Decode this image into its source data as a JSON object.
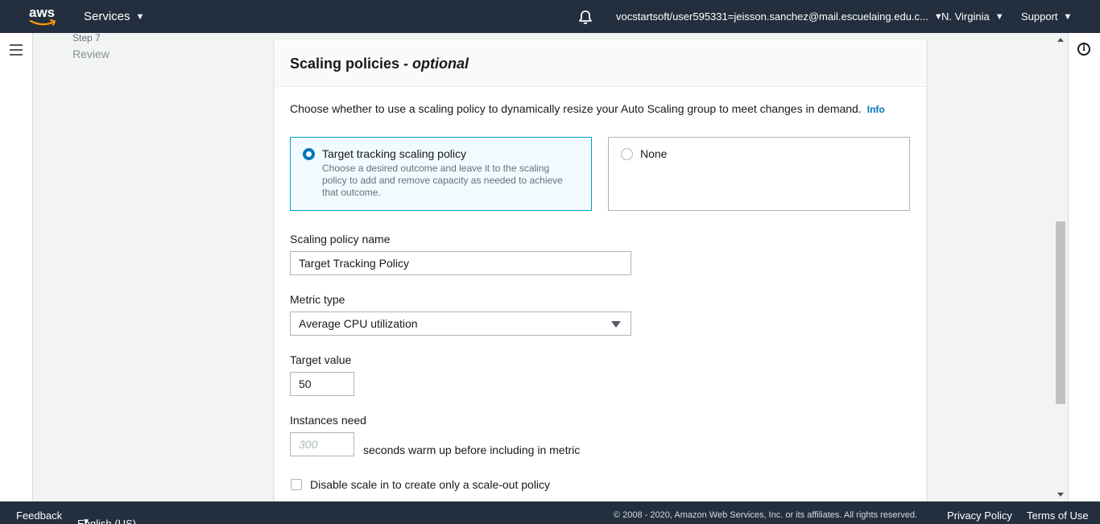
{
  "topnav": {
    "logo": "aws",
    "services": "Services",
    "account": "vocstartsoft/user595331=jeisson.sanchez@mail.escuelaing.edu.c...",
    "region": "N. Virginia",
    "support": "Support"
  },
  "steps": {
    "current_step_number": "Step 7",
    "current_step_label": "Review"
  },
  "section": {
    "title": "Scaling policies - ",
    "title_suffix": "optional",
    "description": "Choose whether to use a scaling policy to dynamically resize your Auto Scaling group to meet changes in demand.",
    "info_link": "Info"
  },
  "policy_options": [
    {
      "title": "Target tracking scaling policy",
      "description": "Choose a desired outcome and leave it to the scaling policy to add and remove capacity as needed to achieve that outcome.",
      "selected": true
    },
    {
      "title": "None",
      "description": "",
      "selected": false
    }
  ],
  "form": {
    "policy_name_label": "Scaling policy name",
    "policy_name_value": "Target Tracking Policy",
    "metric_type_label": "Metric type",
    "metric_type_value": "Average CPU utilization",
    "target_value_label": "Target value",
    "target_value": "50",
    "instances_need_label": "Instances need",
    "warmup_placeholder": "300",
    "warmup_suffix": "seconds warm up before including in metric",
    "disable_scale_in_label": "Disable scale in to create only a scale-out policy",
    "disable_scale_in_checked": false
  },
  "footer": {
    "feedback": "Feedback",
    "language": "English (US)",
    "copyright": "© 2008 - 2020, Amazon Web Services, Inc. or its affiliates. All rights reserved.",
    "privacy": "Privacy Policy",
    "terms": "Terms of Use"
  },
  "colors": {
    "nav_bg": "#232f3e",
    "accent": "#0073bb",
    "selected_border": "#00a1c9",
    "aws_smile": "#ff9900"
  },
  "icons": [
    "aws-logo-icon",
    "caret-down-icon",
    "bell-icon",
    "hamburger-icon",
    "info-icon",
    "radio-icon",
    "checkbox-icon"
  ]
}
